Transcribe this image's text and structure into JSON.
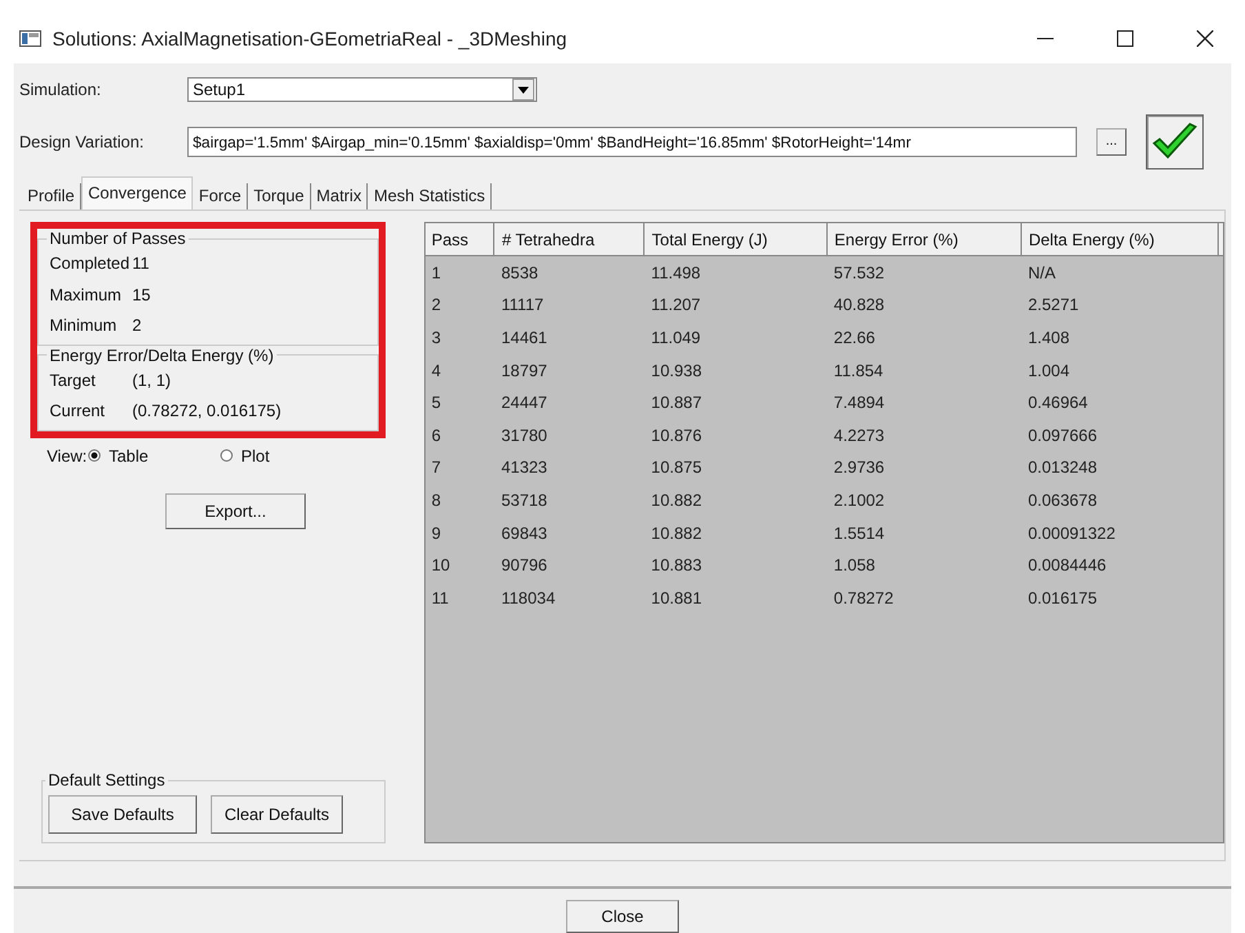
{
  "window": {
    "title": "Solutions: AxialMagnetisation-GEometriaReal - _3DMeshing"
  },
  "simulation": {
    "label": "Simulation:",
    "value": "Setup1"
  },
  "design_variation": {
    "label": "Design Variation:",
    "value": "$airgap='1.5mm' $Airgap_min='0.15mm' $axialdisp='0mm' $BandHeight='16.85mm' $RotorHeight='14mr",
    "browse_button": "...",
    "status_checked": true
  },
  "tabs": [
    {
      "label": "Profile",
      "selected": false
    },
    {
      "label": "Convergence",
      "selected": true
    },
    {
      "label": "Force",
      "selected": false
    },
    {
      "label": "Torque",
      "selected": false
    },
    {
      "label": "Matrix",
      "selected": false
    },
    {
      "label": "Mesh Statistics",
      "selected": false
    }
  ],
  "summary": {
    "highlighted": true,
    "groups": [
      {
        "title": "Number of Passes",
        "rows": [
          {
            "label": "Completed",
            "value": "11"
          },
          {
            "label": "Maximum",
            "value": "15"
          },
          {
            "label": "Minimum",
            "value": "2"
          }
        ]
      },
      {
        "title": "Energy Error/Delta Energy (%)",
        "rows": [
          {
            "label": "Target",
            "value": "(1, 1)"
          },
          {
            "label": "Current",
            "value": "(0.78272, 0.016175)"
          }
        ]
      }
    ]
  },
  "view": {
    "label": "View:",
    "options": [
      {
        "label": "Table",
        "selected": true
      },
      {
        "label": "Plot",
        "selected": false
      }
    ]
  },
  "export_button": "Export...",
  "default_settings": {
    "title": "Default Settings",
    "buttons": [
      "Save Defaults",
      "Clear Defaults"
    ]
  },
  "table": {
    "columns": [
      "Pass",
      "# Tetrahedra",
      "Total Energy (J)",
      "Energy Error (%)",
      "Delta Energy (%)"
    ],
    "rows": [
      [
        "1",
        "8538",
        "11.498",
        "57.532",
        "N/A"
      ],
      [
        "2",
        "11117",
        "11.207",
        "40.828",
        "2.5271"
      ],
      [
        "3",
        "14461",
        "11.049",
        "22.66",
        "1.408"
      ],
      [
        "4",
        "18797",
        "10.938",
        "11.854",
        "1.004"
      ],
      [
        "5",
        "24447",
        "10.887",
        "7.4894",
        "0.46964"
      ],
      [
        "6",
        "31780",
        "10.876",
        "4.2273",
        "0.097666"
      ],
      [
        "7",
        "41323",
        "10.875",
        "2.9736",
        "0.013248"
      ],
      [
        "8",
        "53718",
        "10.882",
        "2.1002",
        "0.063678"
      ],
      [
        "9",
        "69843",
        "10.882",
        "1.5514",
        "0.00091322"
      ],
      [
        "10",
        "90796",
        "10.883",
        "1.058",
        "0.0084446"
      ],
      [
        "11",
        "118034",
        "10.881",
        "0.78272",
        "0.016175"
      ]
    ]
  },
  "close_button": "Close"
}
